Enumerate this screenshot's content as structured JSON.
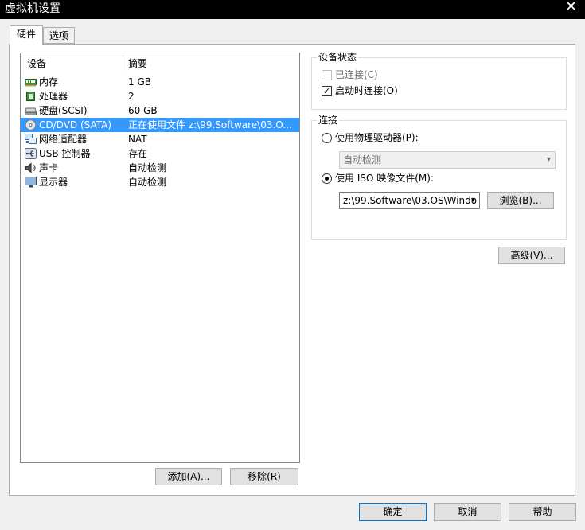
{
  "window": {
    "title": "虚拟机设置",
    "close_glyph": "✕"
  },
  "tabs": [
    {
      "label": "硬件"
    },
    {
      "label": "选项"
    }
  ],
  "device_list": {
    "columns": {
      "device": "设备",
      "summary": "摘要"
    },
    "rows": [
      {
        "icon": "memory-icon",
        "device": "内存",
        "summary": "1 GB"
      },
      {
        "icon": "processor-icon",
        "device": "处理器",
        "summary": "2"
      },
      {
        "icon": "hard-disk-icon",
        "device": "硬盘(SCSI)",
        "summary": "60 GB"
      },
      {
        "icon": "cd-dvd-icon",
        "device": "CD/DVD (SATA)",
        "summary": "正在使用文件 z:\\99.Software\\03.O...",
        "selected": true
      },
      {
        "icon": "network-adapter-icon",
        "device": "网络适配器",
        "summary": "NAT"
      },
      {
        "icon": "usb-icon",
        "device": "USB 控制器",
        "summary": "存在"
      },
      {
        "icon": "sound-card-icon",
        "device": "声卡",
        "summary": "自动检测"
      },
      {
        "icon": "display-icon",
        "device": "显示器",
        "summary": "自动检测"
      }
    ],
    "add_button": "添加(A)...",
    "remove_button": "移除(R)"
  },
  "device_status": {
    "title": "设备状态",
    "connected": {
      "label": "已连接(C)",
      "checked": false,
      "enabled": false
    },
    "connect_at_power_on": {
      "label": "启动时连接(O)",
      "checked": true
    }
  },
  "connection": {
    "title": "连接",
    "physical_drive": {
      "label": "使用物理驱动器(P):",
      "selected": false,
      "value": "自动检测"
    },
    "iso_image": {
      "label": "使用 ISO 映像文件(M):",
      "selected": true,
      "value": "z:\\99.Software\\03.OS\\Windo"
    },
    "browse_button": "浏览(B)..."
  },
  "advanced_button": "高级(V)...",
  "footer": {
    "ok": "确定",
    "cancel": "取消",
    "help": "帮助"
  },
  "colors": {
    "selection": "#3399ff",
    "focus_border": "#0078d7"
  }
}
